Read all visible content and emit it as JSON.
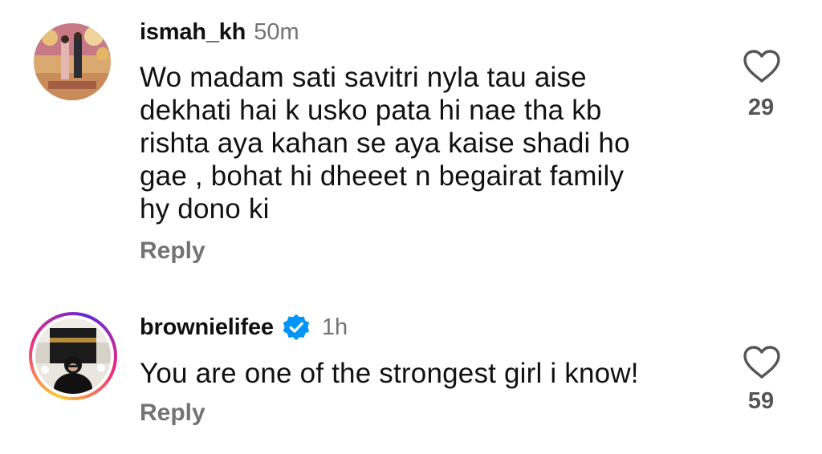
{
  "comments": [
    {
      "username": "ismah_kh",
      "time": "50m",
      "verified": false,
      "text_lines": [
        "Wo madam sati savitri nyla tau aise",
        "dekhati hai k usko pata hi nae tha kb",
        "rishta aya kahan se aya kaise shadi ho",
        "gae , bohat hi dheeet n begairat family",
        "hy dono ki"
      ],
      "reply_label": "Reply",
      "like_count": "29",
      "like_icon": "heart-outline-icon"
    },
    {
      "username": "brownielifee",
      "time": "1h",
      "verified": true,
      "text_lines": [
        "You are one of the strongest girl i know!"
      ],
      "reply_label": "Reply",
      "like_count": "59",
      "like_icon": "heart-outline-icon",
      "story_ring": true
    }
  ],
  "colors": {
    "text": "#111111",
    "secondary": "#737373",
    "verified_blue": "#0095f6"
  }
}
